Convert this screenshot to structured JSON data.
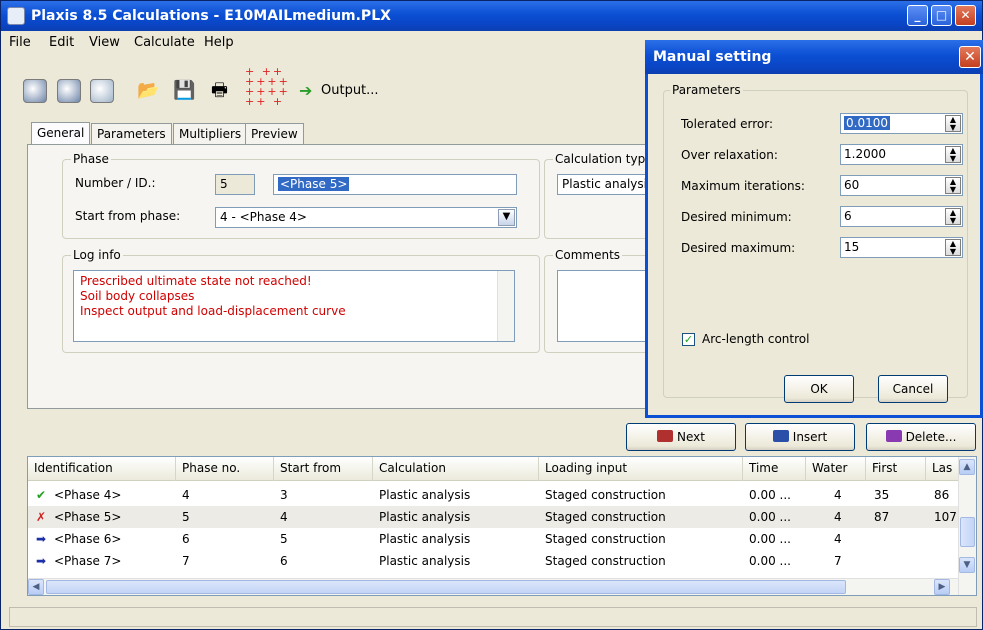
{
  "window": {
    "title": "Plaxis 8.5 Calculations - E10MAILmedium.PLX",
    "controls": {
      "minimize": "_",
      "maximize": "□",
      "close": "✕"
    }
  },
  "menu": [
    "File",
    "Edit",
    "View",
    "Calculate",
    "Help"
  ],
  "toolbar": {
    "icons": [
      "globe-icon",
      "globe-alt-icon",
      "mesh-icon",
      "open-folder-icon",
      "save-icon",
      "print-icon",
      "points-icon",
      "arrow-right-icon"
    ],
    "output_label": "Output..."
  },
  "tabs": [
    "General",
    "Parameters",
    "Multipliers",
    "Preview"
  ],
  "general": {
    "phase_group": "Phase",
    "number_label": "Number / ID.:",
    "number_value": "5",
    "id_value": "<Phase 5>",
    "start_from_label": "Start from phase:",
    "start_from_value": "4 - <Phase 4>",
    "calc_type_group": "Calculation type",
    "calc_type_value": "Plastic analysis",
    "log_group": "Log info",
    "log_lines": [
      "Prescribed ultimate state not reached!",
      "Soil body collapses",
      "Inspect output and load-displacement curve"
    ],
    "comments_group": "Comments"
  },
  "buttons": {
    "next": "Next",
    "insert": "Insert",
    "delete": "Delete..."
  },
  "table": {
    "headers": [
      "Identification",
      "Phase no.",
      "Start from",
      "Calculation",
      "Loading input",
      "Time",
      "Water",
      "First",
      "Las"
    ],
    "rows": [
      {
        "status": "✔",
        "id": "<Phase 4>",
        "phase_no": "4",
        "start": "3",
        "calc": "Plastic analysis",
        "loading": "Staged construction",
        "time": "0.00 ...",
        "water": "4",
        "first": "35",
        "last": "86"
      },
      {
        "status": "✗",
        "id": "<Phase 5>",
        "phase_no": "5",
        "start": "4",
        "calc": "Plastic analysis",
        "loading": "Staged construction",
        "time": "0.00 ...",
        "water": "4",
        "first": "87",
        "last": "107"
      },
      {
        "status": "➡",
        "id": "<Phase 6>",
        "phase_no": "6",
        "start": "5",
        "calc": "Plastic analysis",
        "loading": "Staged construction",
        "time": "0.00 ...",
        "water": "4",
        "first": "",
        "last": ""
      },
      {
        "status": "➡",
        "id": "<Phase 7>",
        "phase_no": "7",
        "start": "6",
        "calc": "Plastic analysis",
        "loading": "Staged construction",
        "time": "0.00 ...",
        "water": "7",
        "first": "",
        "last": ""
      }
    ]
  },
  "dialog": {
    "title": "Manual setting",
    "group": "Parameters",
    "fields": [
      {
        "label": "Tolerated error:",
        "value": "0.0100"
      },
      {
        "label": "Over relaxation:",
        "value": "1.2000"
      },
      {
        "label": "Maximum iterations:",
        "value": "60"
      },
      {
        "label": "Desired minimum:",
        "value": "6"
      },
      {
        "label": "Desired maximum:",
        "value": "15"
      }
    ],
    "arc_length_label": "Arc-length control",
    "arc_length_checked": true,
    "ok": "OK",
    "cancel": "Cancel"
  },
  "colors": {
    "titlebar": "#0b4fd4",
    "log_text": "#d00000",
    "selection": "#316ac5"
  }
}
